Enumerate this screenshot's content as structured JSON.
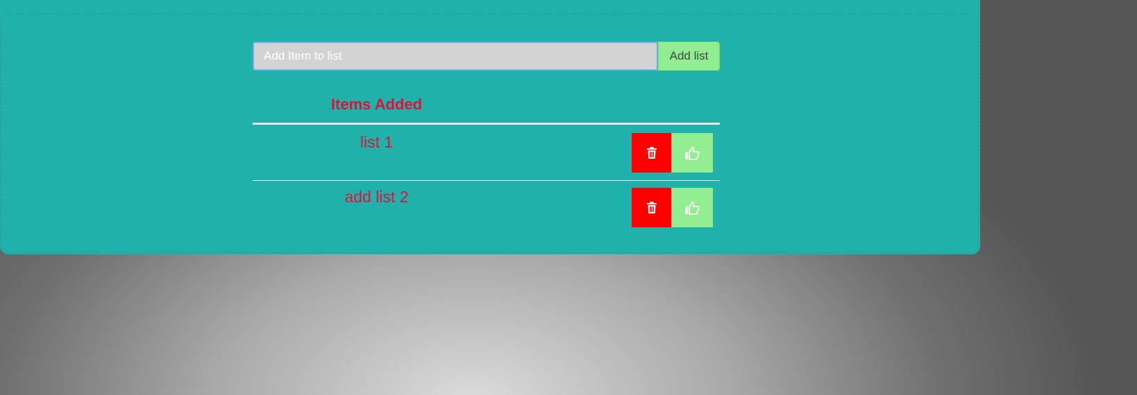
{
  "form": {
    "input_placeholder": "Add Item to list",
    "input_value": "",
    "add_button_label": "Add list"
  },
  "list": {
    "heading": "Items Added",
    "items": [
      {
        "text": "list 1",
        "delete_icon": "trash-icon",
        "like_icon": "thumbs-up-icon"
      },
      {
        "text": "add list 2",
        "delete_icon": "trash-icon",
        "like_icon": "thumbs-up-icon"
      }
    ]
  },
  "colors": {
    "panel": "#20b2aa",
    "accent_text": "#dc143c",
    "delete": "#ff0000",
    "like": "#90ee90",
    "input_bg": "#d3d3d3"
  }
}
